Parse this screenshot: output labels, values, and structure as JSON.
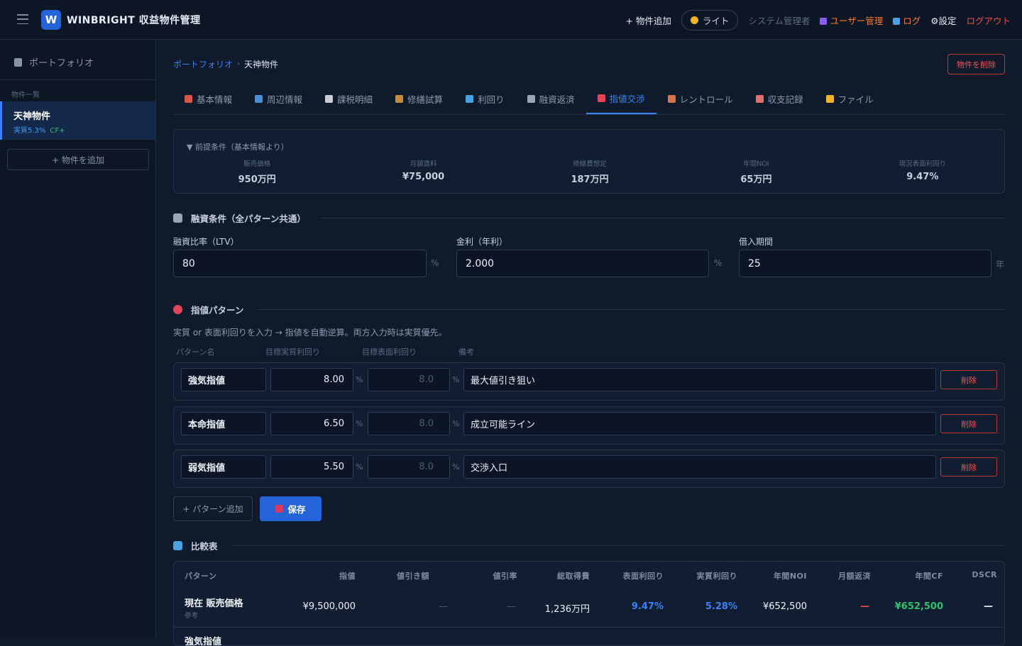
{
  "app": {
    "logo_letter": "W",
    "title": "WINBRIGHT 収益物件管理"
  },
  "topnav": {
    "add_property": "+ 物件追加",
    "theme": "ライト",
    "admin": "システム管理者",
    "users": "ユーザー管理",
    "log": "ログ",
    "settings": "⚙設定",
    "logout": "ログアウト"
  },
  "sidebar": {
    "header": "ポートフォリオ",
    "section": "物件一覧",
    "items": [
      {
        "name": "天神物件",
        "yield": "実質5.3%",
        "cf": "CF+"
      }
    ],
    "add_button": "+ 物件を追加"
  },
  "breadcrumb": {
    "root": "ポートフォリオ",
    "sep": "›",
    "current": "天神物件"
  },
  "delete_property": "物件を削除",
  "tabs": [
    {
      "label": "基本情報",
      "icon": "clipboard-icon",
      "color": "#d9534f"
    },
    {
      "label": "周辺情報",
      "icon": "map-icon",
      "color": "#4a8fd8"
    },
    {
      "label": "課税明細",
      "icon": "document-icon",
      "color": "#c9ced6"
    },
    {
      "label": "修繕試算",
      "icon": "hammer-icon",
      "color": "#c98a3a"
    },
    {
      "label": "利回り",
      "icon": "chart-icon",
      "color": "#4aa3e0"
    },
    {
      "label": "融資返済",
      "icon": "bank-icon",
      "color": "#9aa6b8"
    },
    {
      "label": "指値交渉",
      "icon": "target-icon",
      "color": "#e0455a"
    },
    {
      "label": "レントロール",
      "icon": "house-icon",
      "color": "#d9744a"
    },
    {
      "label": "収支記録",
      "icon": "receipt-icon",
      "color": "#e07070"
    },
    {
      "label": "ファイル",
      "icon": "folder-icon",
      "color": "#f0b429"
    }
  ],
  "active_tab": "指値交渉",
  "premise": {
    "title": "▼ 前提条件（基本情報より）",
    "items": [
      {
        "label": "販売価格",
        "value": "950万円"
      },
      {
        "label": "月額賃料",
        "value": "¥75,000"
      },
      {
        "label": "修繕費想定",
        "value": "187万円"
      },
      {
        "label": "年間NOI",
        "value": "65万円"
      },
      {
        "label": "現況表面利回り",
        "value": "9.47%"
      }
    ]
  },
  "loan": {
    "title": "融資条件（全パターン共通）",
    "ltv": {
      "label": "融資比率（LTV）",
      "value": "80",
      "unit": "%"
    },
    "rate": {
      "label": "金利（年利）",
      "value": "2.000",
      "unit": "%"
    },
    "term": {
      "label": "借入期間",
      "value": "25",
      "unit": "年"
    }
  },
  "patterns": {
    "title": "指値パターン",
    "hint": "実質 or 表面利回りを入力 → 指値を自動逆算。両方入力時は実質優先。",
    "headers": [
      "パターン名",
      "目標実質利回り",
      "目標表面利回り",
      "備考"
    ],
    "unit": "%",
    "delete_label": "削除",
    "rows": [
      {
        "name": "強気指値",
        "net": "8.00",
        "gross": "8.0",
        "note": "最大値引き狙い"
      },
      {
        "name": "本命指値",
        "net": "6.50",
        "gross": "8.0",
        "note": "成立可能ライン"
      },
      {
        "name": "弱気指値",
        "net": "5.50",
        "gross": "8.0",
        "note": "交渉入口"
      }
    ],
    "add_label": "+ パターン追加",
    "save_label": "保存"
  },
  "compare": {
    "title": "比較表",
    "headers": [
      "パターン",
      "指値",
      "値引き額",
      "値引率",
      "総取得費",
      "表面利回り",
      "実質利回り",
      "年間NOI",
      "月額返済",
      "年間CF",
      "DSCR"
    ],
    "rows": [
      {
        "name": "現在 販売価格",
        "sub": "参考",
        "price": "¥9,500,000",
        "discount": "—",
        "discount_rate": "—",
        "total": "1,236万円",
        "gross": "9.47%",
        "net": "5.28%",
        "noi": "¥652,500",
        "monthly": "—",
        "cf": "¥652,500",
        "dscr": "—"
      }
    ],
    "next_row": "強気指値"
  }
}
